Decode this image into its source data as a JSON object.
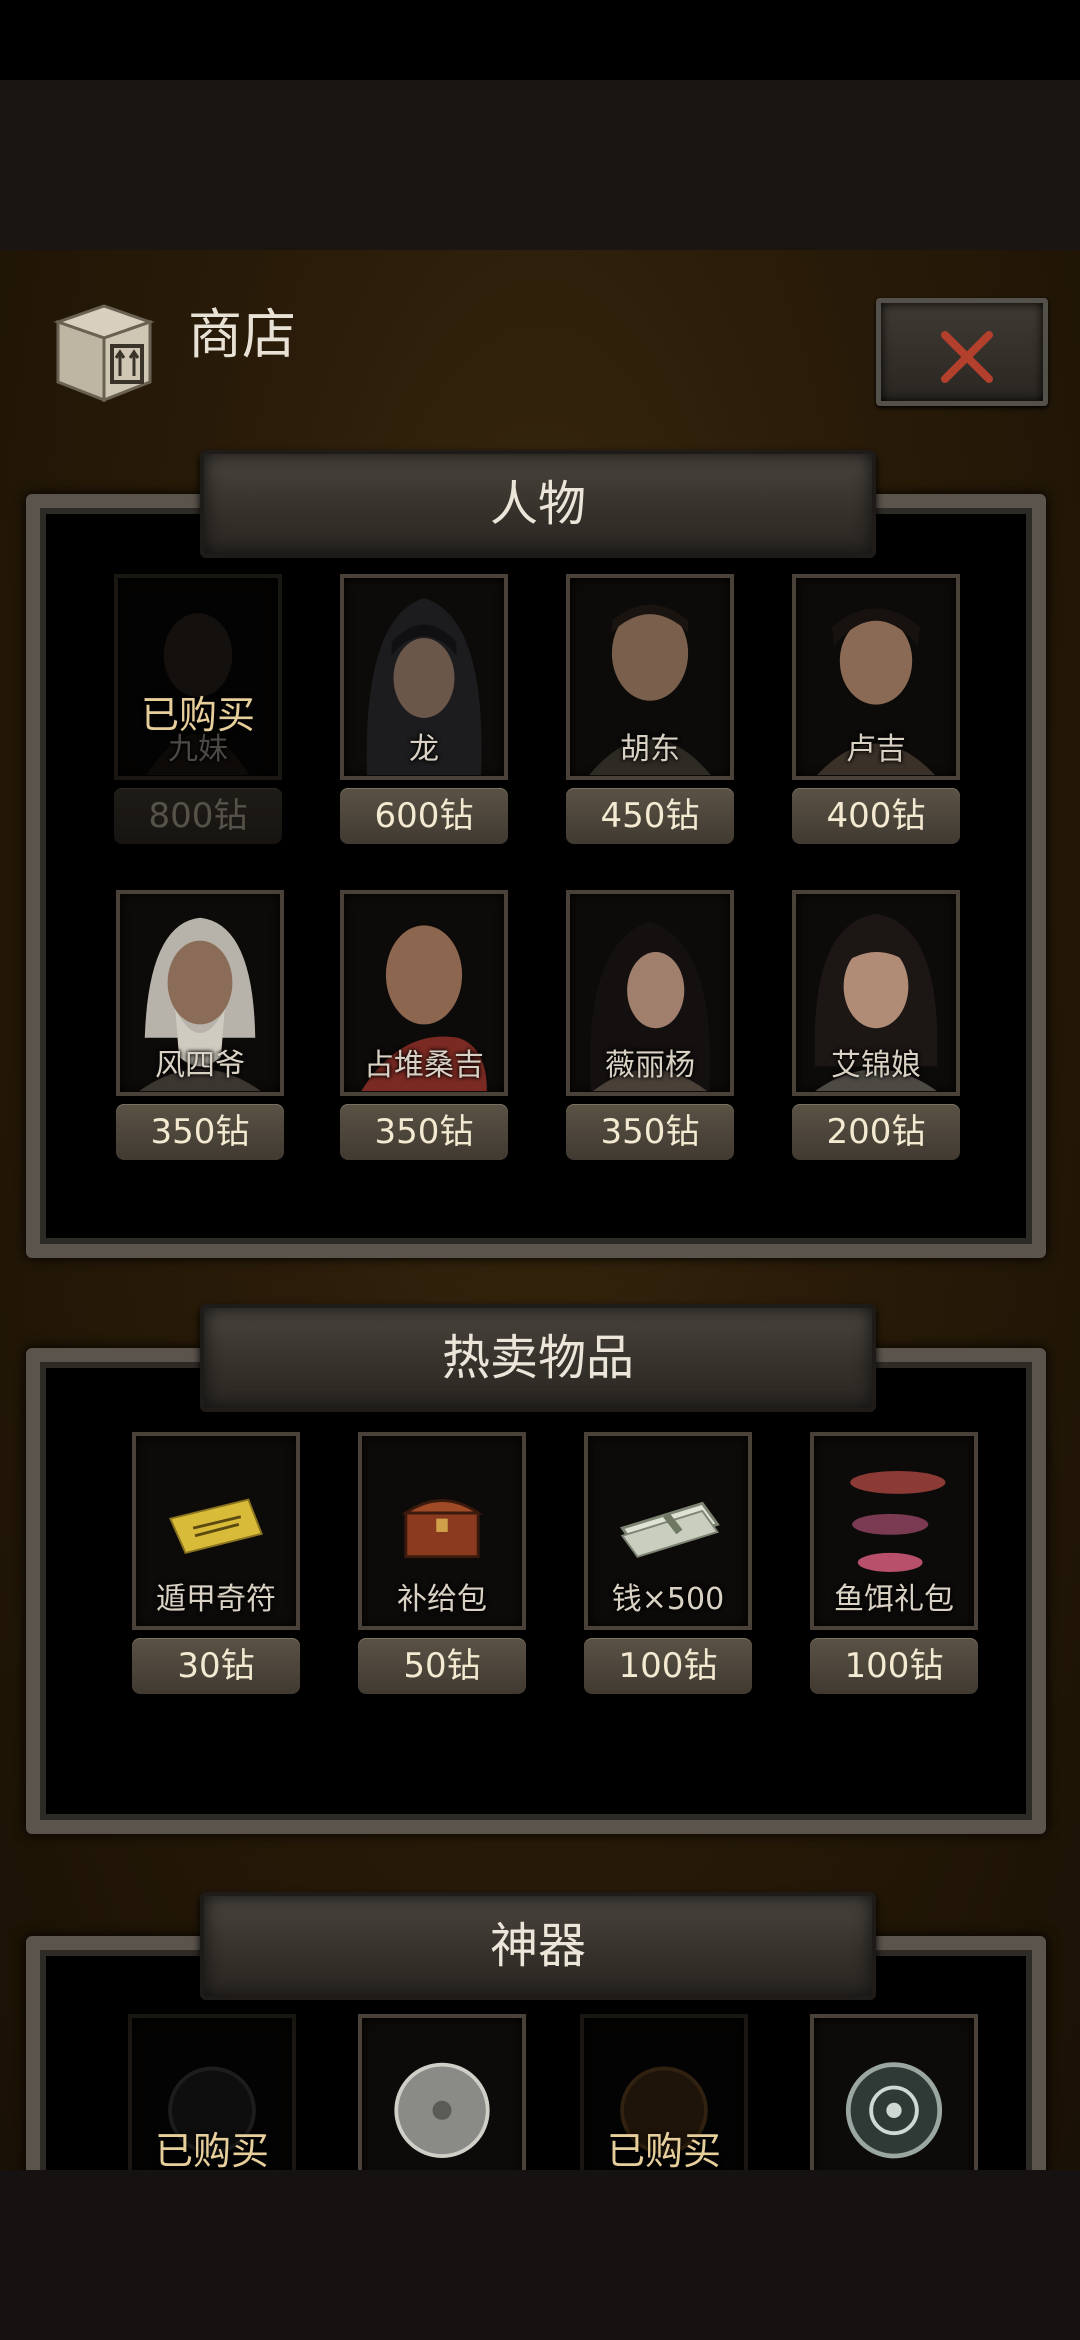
{
  "header": {
    "title": "商店"
  },
  "sections": [
    {
      "title": "人物",
      "cards": [
        {
          "name": "九妹",
          "price": "800钻",
          "bought": true,
          "bought_label": "已购买"
        },
        {
          "name": "龙",
          "price": "600钻"
        },
        {
          "name": "胡东",
          "price": "450钻"
        },
        {
          "name": "卢吉",
          "price": "400钻"
        },
        {
          "name": "风四爷",
          "price": "350钻"
        },
        {
          "name": "占堆桑吉",
          "price": "350钻"
        },
        {
          "name": "薇丽杨",
          "price": "350钻"
        },
        {
          "name": "艾锦娘",
          "price": "200钻"
        }
      ]
    },
    {
      "title": "热卖物品",
      "cards": [
        {
          "name": "遁甲奇符",
          "price": "30钻",
          "icon": "talisman-icon"
        },
        {
          "name": "补给包",
          "price": "50钻",
          "icon": "chest-icon"
        },
        {
          "name": "钱×500",
          "price": "100钻",
          "icon": "money-icon"
        },
        {
          "name": "鱼饵礼包",
          "price": "100钻",
          "icon": "lure-icon"
        }
      ]
    },
    {
      "title": "神器",
      "cards": [
        {
          "bought": true,
          "bought_label": "已购买",
          "icon": "disc-icon"
        },
        {
          "icon": "disc-icon"
        },
        {
          "bought": true,
          "bought_label": "已购买",
          "icon": "disc-icon"
        },
        {
          "icon": "disc-icon"
        }
      ]
    }
  ],
  "colors": {
    "price_bg": "#4d463c",
    "accent_close": "#b2402c",
    "bought_text": "#e7cf9c"
  }
}
